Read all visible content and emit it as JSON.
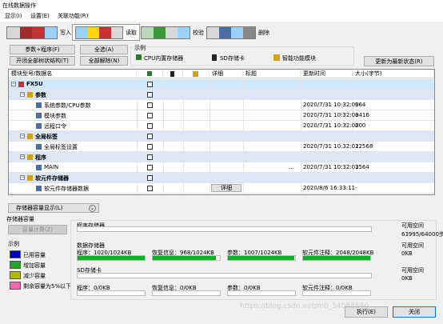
{
  "window": {
    "title": "在线数据操作"
  },
  "menu": [
    {
      "label": "显示(I)"
    },
    {
      "label": "设置(E)"
    },
    {
      "label": "关联功能(R)"
    }
  ],
  "tabs": [
    {
      "label": "写入",
      "active": false
    },
    {
      "label": "读取",
      "active": true
    },
    {
      "label": "校验",
      "active": false
    },
    {
      "label": "删除",
      "active": false
    }
  ],
  "actions": {
    "param_program": "参数+程序(F)",
    "select_all": "全选(A)",
    "expand_all": "开闭全部树状结构(T)",
    "deselect_all": "全部解除(N)",
    "refresh_latest": "更新为最新状态(R)"
  },
  "legend": {
    "title": "示例",
    "items": [
      {
        "icon": "cpu-memory-icon",
        "label": "CPU内置存储器"
      },
      {
        "icon": "sd-card-icon",
        "label": "SD存储卡"
      },
      {
        "icon": "intelligent-module-icon",
        "label": "智能功能模块"
      }
    ]
  },
  "tree": {
    "columns": [
      "模块型号/数据名",
      "",
      "",
      "",
      "详细",
      "标题",
      "更新时间",
      "大小(字节)"
    ],
    "rows": [
      {
        "indent": 0,
        "name": "FX5U",
        "time": "",
        "size": "",
        "kind": "root",
        "title": ""
      },
      {
        "indent": 1,
        "name": "参数",
        "time": "",
        "size": "",
        "kind": "group",
        "title": ""
      },
      {
        "indent": 2,
        "name": "系统参数/CPU参数",
        "time": "2020/7/31 10:32:00",
        "size": "964",
        "kind": "item",
        "title": ""
      },
      {
        "indent": 2,
        "name": "模块参数",
        "time": "2020/7/31 10:32:00",
        "size": "3416",
        "kind": "item",
        "title": ""
      },
      {
        "indent": 2,
        "name": "远程口令",
        "time": "2020/7/31 10:32:00",
        "size": "200",
        "kind": "item",
        "title": ""
      },
      {
        "indent": 1,
        "name": "全局标签",
        "time": "",
        "size": "",
        "kind": "group",
        "title": ""
      },
      {
        "indent": 2,
        "name": "全局标签设置",
        "time": "2020/7/31 10:32:02",
        "size": "12568",
        "kind": "item",
        "title": ""
      },
      {
        "indent": 1,
        "name": "程序",
        "time": "",
        "size": "",
        "kind": "group",
        "title": ""
      },
      {
        "indent": 2,
        "name": "MAIN",
        "time": "2020/7/31 10:32:02",
        "size": "3564",
        "kind": "item",
        "title": "..."
      },
      {
        "indent": 1,
        "name": "软元件存储器",
        "time": "",
        "size": "",
        "kind": "group",
        "title": ""
      },
      {
        "indent": 2,
        "name": "软元件存储器数据",
        "time": "2020/8/6 16:33:11",
        "size": "-",
        "kind": "item",
        "title": "",
        "detail": "详细"
      }
    ]
  },
  "capacity": {
    "toggle_label": "存储器容量显示(L)",
    "group_label": "存储器容量",
    "calc_button": "容量计算(Z)",
    "legend_title": "示例",
    "legend": [
      {
        "label": "已用容量",
        "color": "#0000c8"
      },
      {
        "label": "增加容量",
        "color": "#1fa81f"
      },
      {
        "label": "减少容量",
        "color": "#b8b800"
      },
      {
        "label": "剩余容量为5%以下",
        "color": "#ff66b3"
      }
    ],
    "program_memory": {
      "title": "程序存储器",
      "free_label": "可用空间",
      "free_value": "63995/64000步",
      "fill": 0.0001
    },
    "data_memory": {
      "title": "数据存储器",
      "free_label": "可用空间",
      "free_value": "0KB",
      "bars": [
        {
          "label": "程序：1020/1024KB",
          "fill": 0.996
        },
        {
          "label": "恢复信息：968/1024KB",
          "fill": 0.945
        },
        {
          "label": "参数：1007/1024KB",
          "fill": 0.983
        },
        {
          "label": "软元件注释：2048/2048KB",
          "fill": 1.0
        }
      ]
    },
    "sd_card": {
      "title": "SD存储卡",
      "free_label": "可用空间",
      "free_value": "0KB",
      "bars": [
        {
          "label": "程序：0/0KB",
          "fill": 0
        },
        {
          "label": "恢复信息：0/0KB",
          "fill": 0
        },
        {
          "label": "参数：0/0KB",
          "fill": 0
        },
        {
          "label": "软元件注释：0/0KB",
          "fill": 0
        }
      ]
    }
  },
  "footer": {
    "execute": "执行(E)",
    "close": "关闭",
    "watermark": "https://blog.csdn.net/m0_54088590"
  }
}
